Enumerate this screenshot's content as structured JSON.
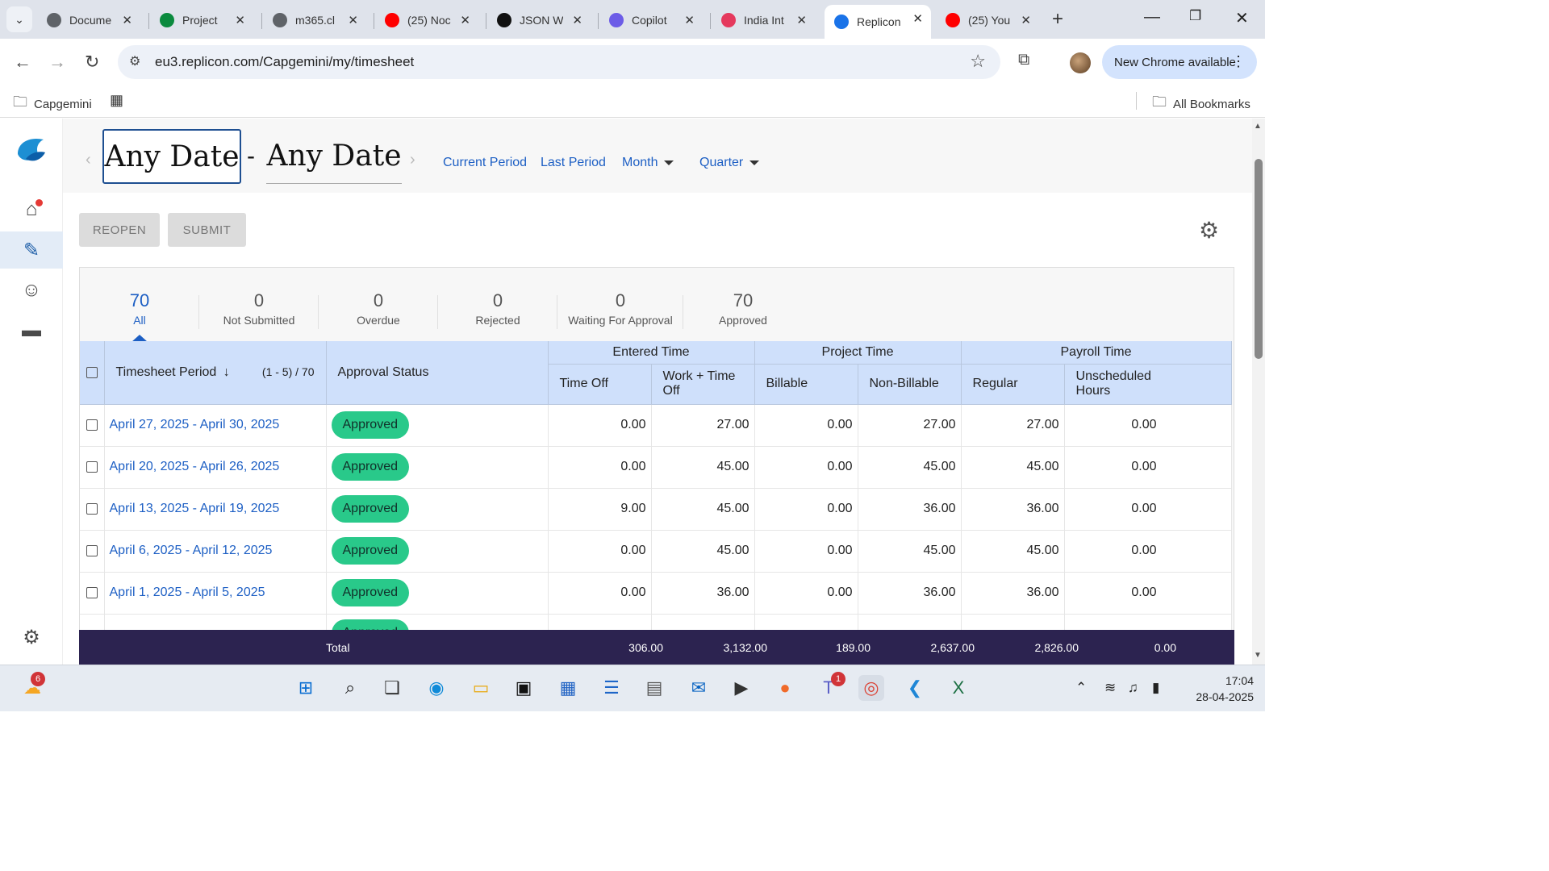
{
  "browser": {
    "tabs": [
      {
        "title": "Docume",
        "icon": "doc-icon",
        "color": "#5f6368"
      },
      {
        "title": "Project",
        "icon": "project-icon",
        "color": "#0b8a3e"
      },
      {
        "title": "m365.cl",
        "icon": "globe-icon",
        "color": "#5f6368"
      },
      {
        "title": "(25) Noc",
        "icon": "youtube-icon",
        "color": "#ff0000"
      },
      {
        "title": "JSON W",
        "icon": "json-icon",
        "color": "#111111"
      },
      {
        "title": "Copilot",
        "icon": "copilot-icon",
        "color": "#6c5ce7"
      },
      {
        "title": "India Int",
        "icon": "t-icon",
        "color": "#e5395d"
      },
      {
        "title": "Replicon",
        "icon": "replicon-icon",
        "color": "#1a73e8",
        "active": true
      },
      {
        "title": "(25) You",
        "icon": "youtube-icon",
        "color": "#ff0000"
      }
    ],
    "url": "eu3.replicon.com/Capgemini/my/timesheet",
    "update_label": "New Chrome available",
    "bookmarks": {
      "folder": "Capgemini",
      "all": "All Bookmarks"
    }
  },
  "datebar": {
    "from": "Any Date",
    "to": "Any Date",
    "dash": "-",
    "links": {
      "current": "Current Period",
      "last": "Last Period",
      "month": "Month",
      "quarter": "Quarter"
    }
  },
  "actions": {
    "reopen": "REOPEN",
    "submit": "SUBMIT"
  },
  "summary": [
    {
      "count": "70",
      "label": "All",
      "active": true
    },
    {
      "count": "0",
      "label": "Not Submitted"
    },
    {
      "count": "0",
      "label": "Overdue"
    },
    {
      "count": "0",
      "label": "Rejected"
    },
    {
      "count": "0",
      "label": "Waiting For Approval"
    },
    {
      "count": "70",
      "label": "Approved"
    }
  ],
  "table": {
    "headers": {
      "period": "Timesheet Period",
      "paging": "(1 - 5) / 70",
      "status": "Approval Status",
      "entered": "Entered Time",
      "project": "Project Time",
      "payroll": "Payroll Time",
      "time_off": "Time Off",
      "work_time_off": "Work + Time Off",
      "billable": "Billable",
      "non_billable": "Non-Billable",
      "regular": "Regular",
      "unscheduled": "Unscheduled Hours"
    },
    "rows": [
      {
        "period": "April 27, 2025 - April 30, 2025",
        "status": "Approved",
        "time_off": "0.00",
        "work_time_off": "27.00",
        "billable": "0.00",
        "non_billable": "27.00",
        "regular": "27.00",
        "unscheduled": "0.00"
      },
      {
        "period": "April 20, 2025 - April 26, 2025",
        "status": "Approved",
        "time_off": "0.00",
        "work_time_off": "45.00",
        "billable": "0.00",
        "non_billable": "45.00",
        "regular": "45.00",
        "unscheduled": "0.00"
      },
      {
        "period": "April 13, 2025 - April 19, 2025",
        "status": "Approved",
        "time_off": "9.00",
        "work_time_off": "45.00",
        "billable": "0.00",
        "non_billable": "36.00",
        "regular": "36.00",
        "unscheduled": "0.00"
      },
      {
        "period": "April 6, 2025 - April 12, 2025",
        "status": "Approved",
        "time_off": "0.00",
        "work_time_off": "45.00",
        "billable": "0.00",
        "non_billable": "45.00",
        "regular": "45.00",
        "unscheduled": "0.00"
      },
      {
        "period": "April 1, 2025 - April 5, 2025",
        "status": "Approved",
        "time_off": "0.00",
        "work_time_off": "36.00",
        "billable": "0.00",
        "non_billable": "36.00",
        "regular": "36.00",
        "unscheduled": "0.00"
      }
    ],
    "partial_row_status": "Approved",
    "totals": {
      "label": "Total",
      "time_off": "306.00",
      "work_time_off": "3,132.00",
      "billable": "189.00",
      "non_billable": "2,637.00",
      "regular": "2,826.00",
      "unscheduled": "0.00"
    }
  },
  "taskbar": {
    "weather_badge": "6",
    "teams_badge": "1",
    "time": "17:04",
    "date": "28-04-2025"
  },
  "colors": {
    "accent": "#1d5fc4",
    "approved": "#29c98a",
    "header": "#cfe0fb",
    "total_bar": "#2c2350"
  }
}
